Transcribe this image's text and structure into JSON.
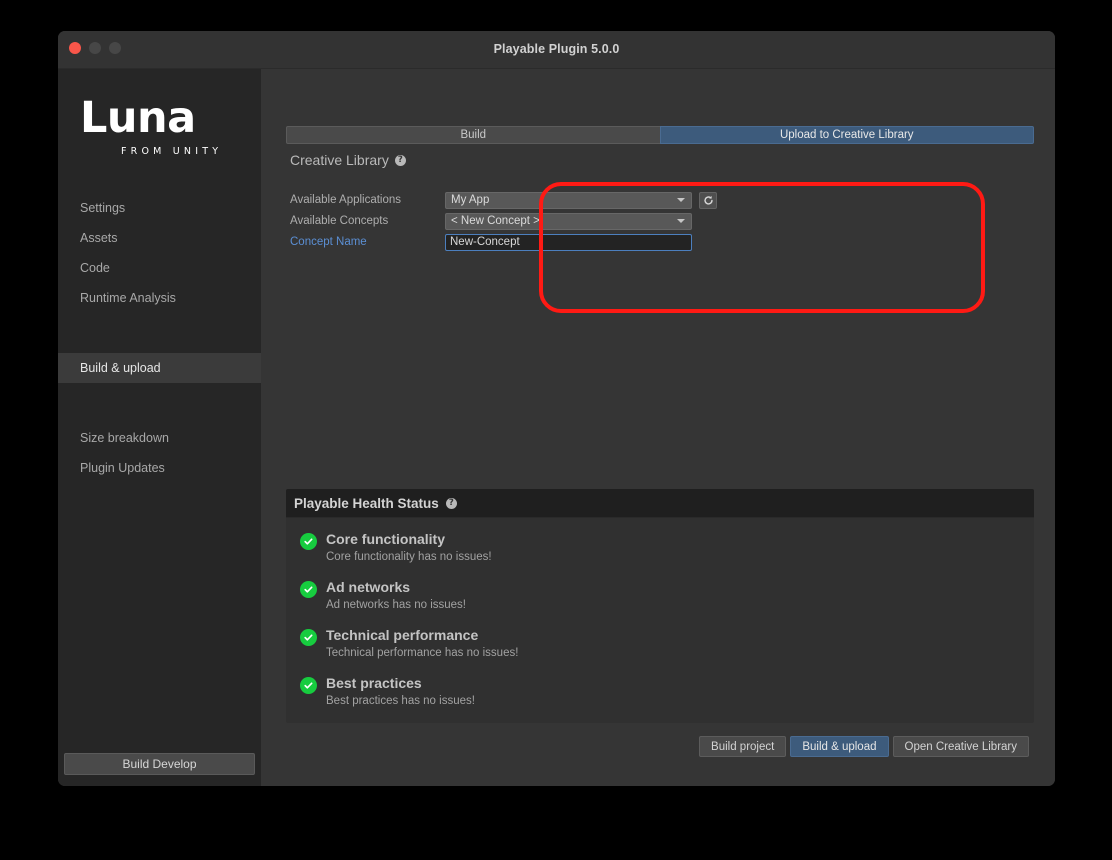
{
  "window": {
    "title": "Playable Plugin 5.0.0",
    "traffic_lights": [
      "close",
      "minimize",
      "maximize"
    ]
  },
  "sidebar": {
    "logo": {
      "wordmark": "Luna",
      "tagline": "FROM UNITY"
    },
    "items": [
      {
        "label": "Settings",
        "selected": false
      },
      {
        "label": "Assets",
        "selected": false
      },
      {
        "label": "Code",
        "selected": false
      },
      {
        "label": "Runtime Analysis",
        "selected": false
      },
      {
        "label": "Build & upload",
        "selected": true
      },
      {
        "label": "Size breakdown",
        "selected": false
      },
      {
        "label": "Plugin Updates",
        "selected": false
      }
    ],
    "footer_button": "Build Develop"
  },
  "tabs": [
    {
      "label": "Build",
      "active": false
    },
    {
      "label": "Upload to Creative Library",
      "active": true
    }
  ],
  "creative_library": {
    "title": "Creative Library",
    "help_glyph": "?",
    "fields": [
      {
        "label": "Available Applications",
        "value": "My App",
        "type": "dropdown",
        "has_refresh": true
      },
      {
        "label": "Available Concepts",
        "value": "< New Concept >",
        "type": "dropdown",
        "has_refresh": false
      },
      {
        "label": "Concept Name",
        "value": "New-Concept",
        "type": "text",
        "label_is_link": true
      }
    ],
    "refresh_icon": "refresh-icon",
    "annotation_color": "#ff1a14"
  },
  "health_status": {
    "title": "Playable Health Status",
    "help_glyph": "?",
    "status_color": "#17cc3f",
    "items": [
      {
        "title": "Core functionality",
        "description": "Core functionality has no issues!",
        "status": "ok"
      },
      {
        "title": "Ad networks",
        "description": "Ad networks has no issues!",
        "status": "ok"
      },
      {
        "title": "Technical performance",
        "description": "Technical performance has no issues!",
        "status": "ok"
      },
      {
        "title": "Best practices",
        "description": "Best practices has no issues!",
        "status": "ok"
      }
    ]
  },
  "bottom_buttons": [
    {
      "label": "Build project",
      "primary": false
    },
    {
      "label": "Build & upload",
      "primary": true
    },
    {
      "label": "Open Creative Library",
      "primary": false
    }
  ]
}
